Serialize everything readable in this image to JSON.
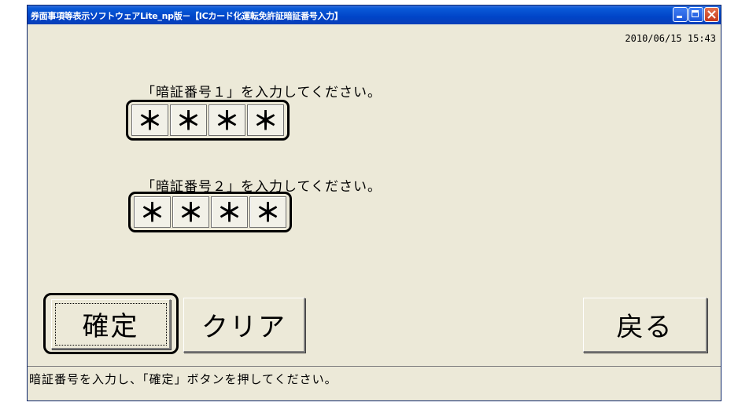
{
  "window": {
    "title": "券面事項等表示ソフトウェアLite_np版－【ICカード化運転免許証暗証番号入力】",
    "accent": "#0a5ad8",
    "background": "#ece9d8"
  },
  "header": {
    "datetime": "2010/06/15 15:43"
  },
  "pin1": {
    "prompt": "「暗証番号１」を入力してください。",
    "digits": [
      "＊",
      "＊",
      "＊",
      "＊"
    ]
  },
  "pin2": {
    "prompt": "「暗証番号２」を入力してください。",
    "digits": [
      "＊",
      "＊",
      "＊",
      "＊"
    ]
  },
  "buttons": {
    "confirm": "確定",
    "clear": "クリア",
    "back": "戻る"
  },
  "status": {
    "message": "暗証番号を入力し、「確定」ボタンを押してください。"
  }
}
